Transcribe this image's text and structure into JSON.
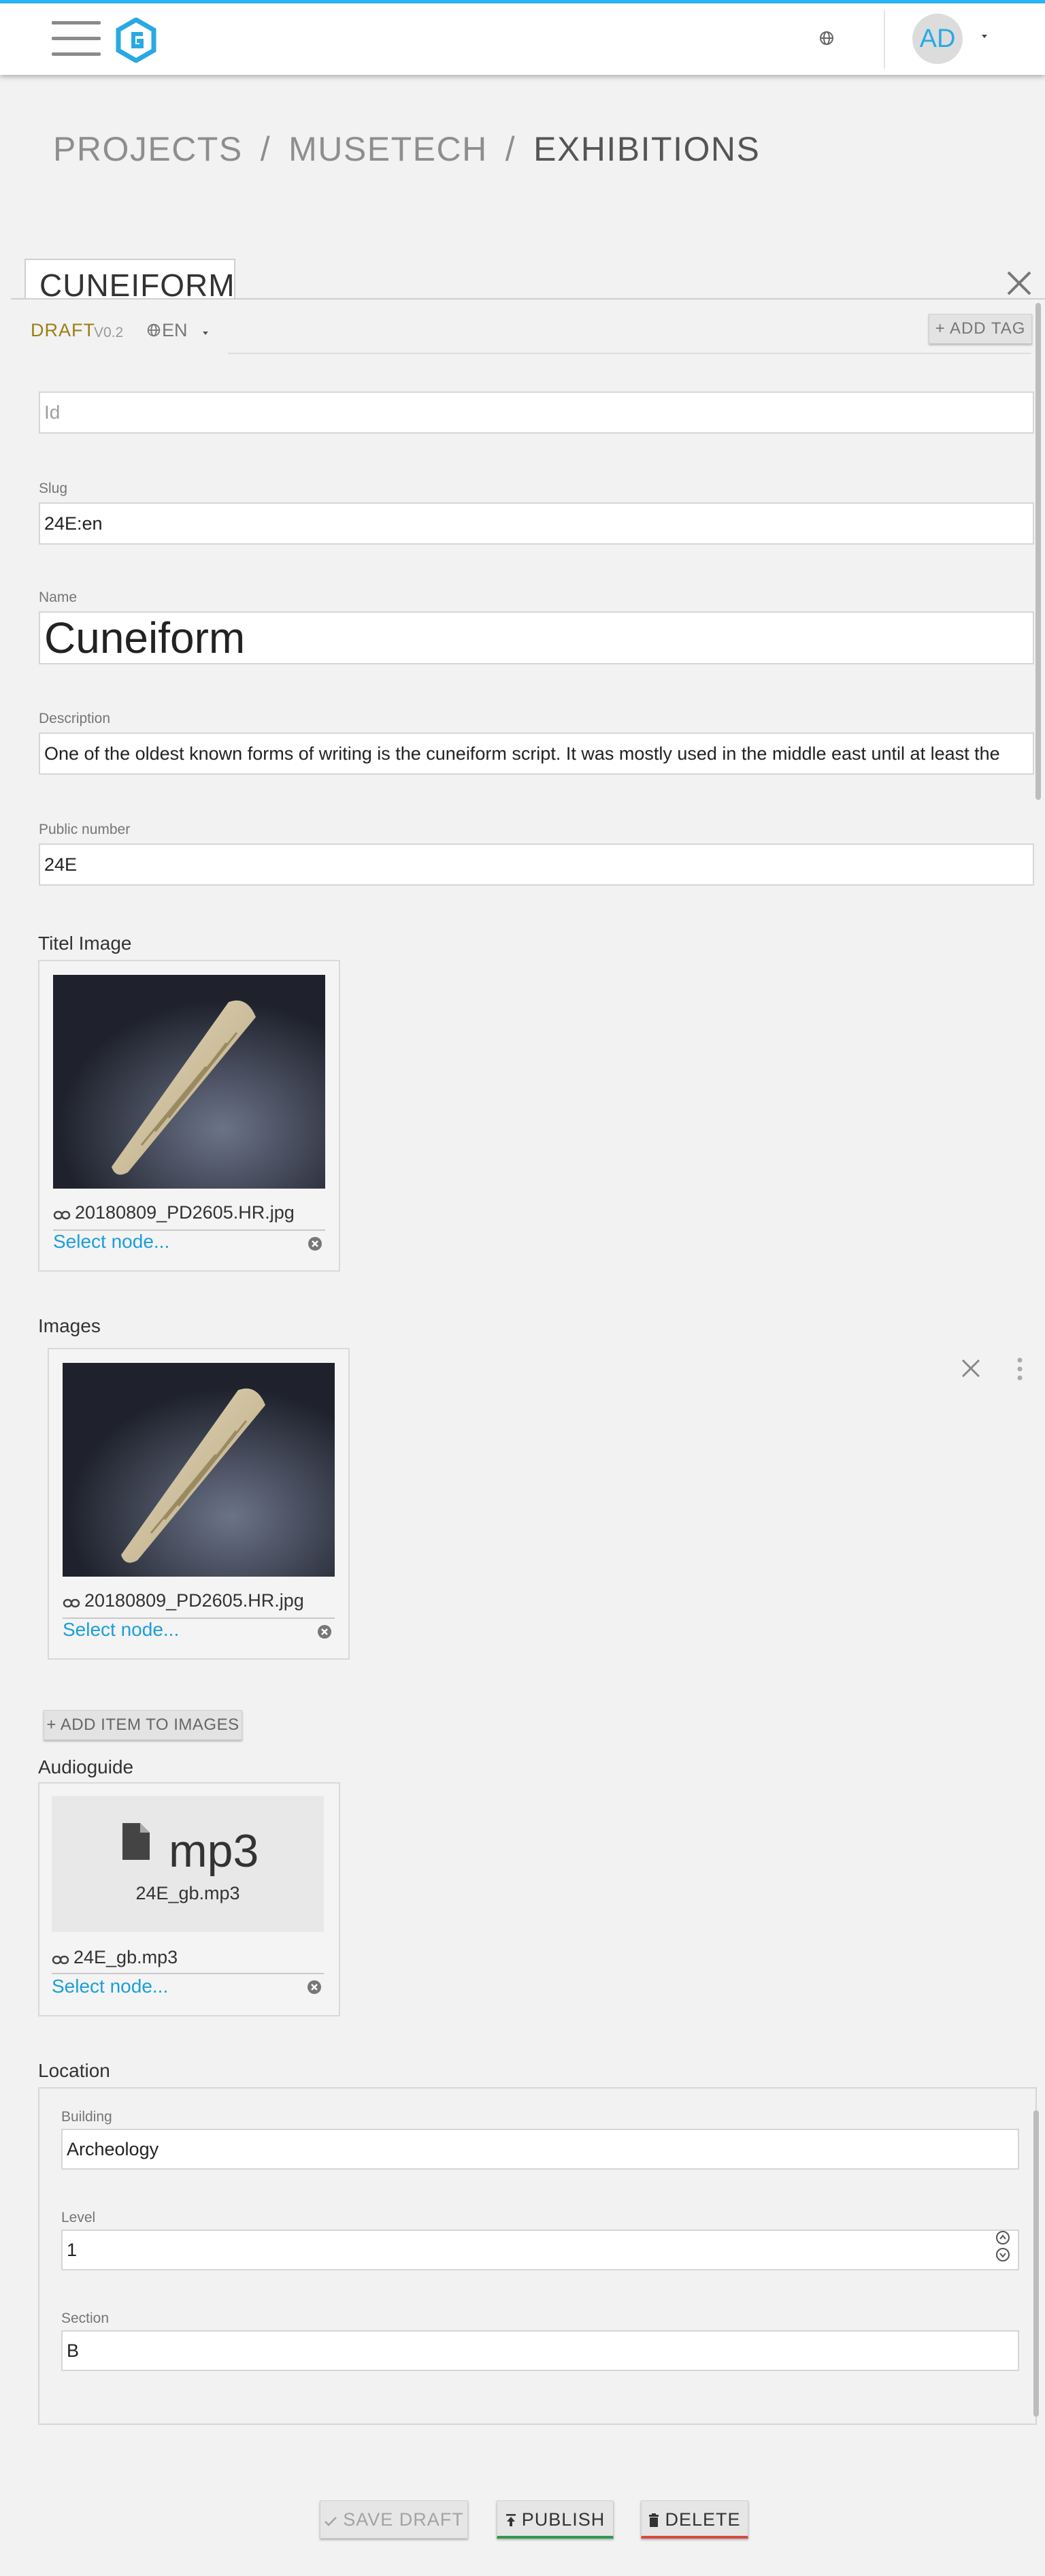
{
  "header": {
    "avatar_initials": "AD"
  },
  "breadcrumb": {
    "items": [
      "PROJECTS",
      "MUSETECH",
      "EXHIBITIONS"
    ],
    "separator": "/"
  },
  "tab": {
    "title": "CUNEIFORM"
  },
  "status": {
    "state": "DRAFT",
    "version": "V0.2",
    "language": "EN",
    "add_tag_label": "+ ADD TAG"
  },
  "fields": {
    "id": {
      "label": "",
      "placeholder": "Id",
      "value": ""
    },
    "slug": {
      "label": "Slug",
      "value": "24E:en"
    },
    "name": {
      "label": "Name",
      "value": "Cuneiform"
    },
    "description": {
      "label": "Description",
      "value": "One of the oldest known forms of writing is the cuneiform script. It was mostly used in the middle east until at least the"
    },
    "public_number": {
      "label": "Public number",
      "value": "24E"
    }
  },
  "title_image": {
    "section_label": "Titel Image",
    "file_name": "20180809_PD2605.HR.jpg",
    "select_label": "Select node..."
  },
  "images": {
    "section_label": "Images",
    "items": [
      {
        "file_name": "20180809_PD2605.HR.jpg",
        "select_label": "Select node..."
      }
    ],
    "add_item_label": "+ ADD ITEM TO IMAGES"
  },
  "audioguide": {
    "section_label": "Audioguide",
    "preview_ext": "mp3",
    "preview_name": "24E_gb.mp3",
    "file_name": "24E_gb.mp3",
    "select_label": "Select node..."
  },
  "location": {
    "section_label": "Location",
    "building": {
      "label": "Building",
      "value": "Archeology"
    },
    "level": {
      "label": "Level",
      "value": "1"
    },
    "section": {
      "label": "Section",
      "value": "B"
    }
  },
  "actions": {
    "save_draft_label": "SAVE DRAFT",
    "publish_label": "PUBLISH",
    "delete_label": "DELETE"
  },
  "colors": {
    "accent": "#29b6f6",
    "link": "#1a9fd9",
    "draft": "#9a7f12",
    "publish_underline": "#2e9a4d",
    "delete_underline": "#d84a3e"
  },
  "icons": [
    "menu-icon",
    "logo-icon",
    "globe-icon",
    "caret-down-icon",
    "close-icon",
    "link-icon",
    "clear-icon",
    "more-vert-icon",
    "file-icon",
    "check-icon",
    "upload-icon",
    "trash-icon"
  ]
}
